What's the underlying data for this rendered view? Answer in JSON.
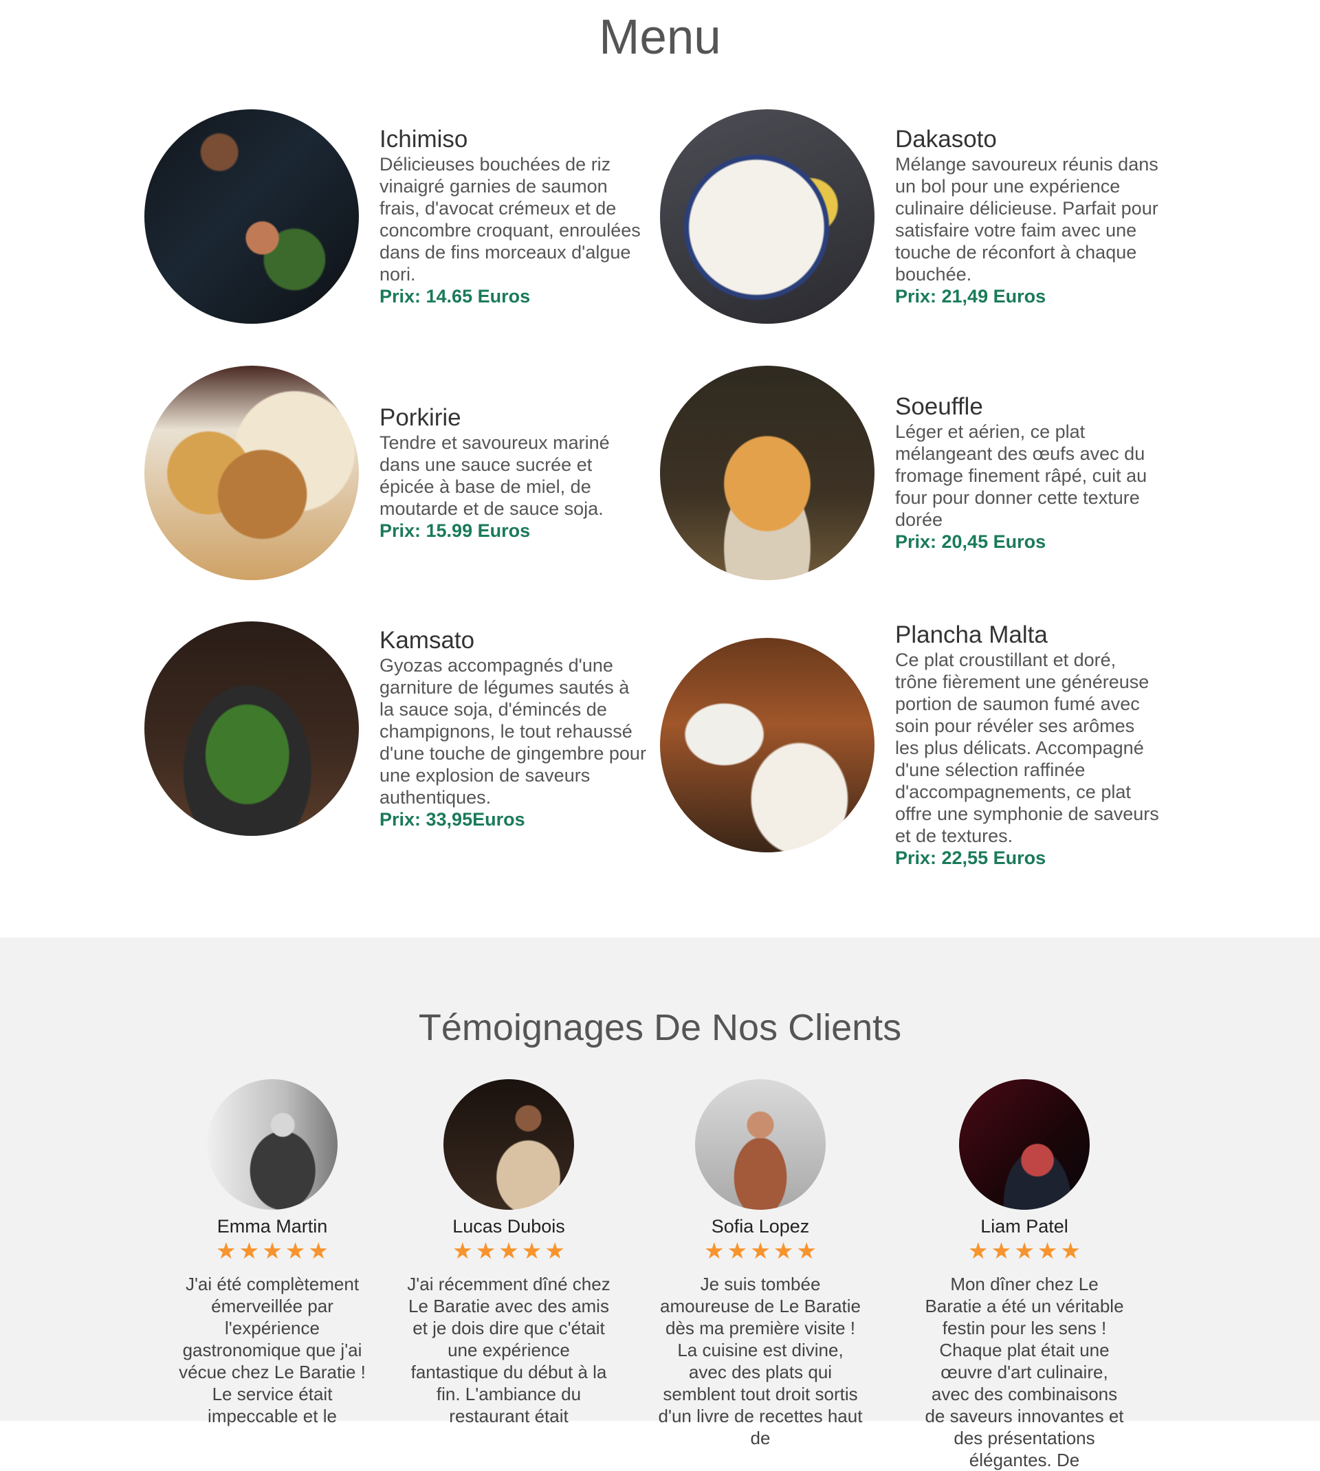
{
  "menu": {
    "title": "Menu",
    "dishes": [
      {
        "name": "Ichimiso",
        "description": "Délicieuses bouchées de riz vinaigré garnies de saumon frais, d'avocat crémeux et de concombre croquant, enroulées dans de fins morceaux d'algue nori.",
        "price": "Prix: 14.65 Euros"
      },
      {
        "name": "Dakasoto",
        "description": "Mélange savoureux réunis dans un bol pour une expérience culinaire délicieuse. Parfait pour satisfaire votre faim avec une touche de réconfort à chaque bouchée.",
        "price": "Prix: 21,49 Euros"
      },
      {
        "name": "Porkirie",
        "description": "Tendre et savoureux mariné dans une sauce sucrée et épicée à base de miel, de moutarde et de sauce soja.",
        "price": "Prix: 15.99 Euros"
      },
      {
        "name": "Soeuffle",
        "description": "Léger et aérien, ce plat mélangeant des œufs avec du fromage finement râpé, cuit au four pour donner cette texture dorée",
        "price": "Prix: 20,45 Euros"
      },
      {
        "name": "Kamsato",
        "description": "Gyozas accompagnés d'une garniture de légumes sautés à la sauce soja, d'émincés de champignons, le tout rehaussé d'une touche de gingembre pour une explosion de saveurs authentiques.",
        "price": "Prix: 33,95Euros"
      },
      {
        "name": "Plancha Malta",
        "description": "Ce plat croustillant et doré, trône fièrement une généreuse portion de saumon fumé avec soin pour révéler ses arômes les plus délicats. Accompagné d'une sélection raffinée d'accompagnements, ce plat offre une symphonie de saveurs et de textures.",
        "price": "Prix: 22,55 Euros"
      }
    ]
  },
  "testimonials": {
    "title": "Témoignages De Nos Clients",
    "rating_max": 5,
    "star_glyph": "★",
    "items": [
      {
        "name": "Emma Martin",
        "rating": 5,
        "quote": "J'ai été complètement émerveillée par l'expérience gastronomique que j'ai vécue chez Le Baratie ! Le service était impeccable et le"
      },
      {
        "name": "Lucas Dubois",
        "rating": 5,
        "quote": "J'ai récemment dîné chez Le Baratie avec des amis et je dois dire que c'était une expérience fantastique du début à la fin. L'ambiance du restaurant était"
      },
      {
        "name": "Sofia Lopez",
        "rating": 5,
        "quote": "Je suis tombée amoureuse de Le Baratie dès ma première visite ! La cuisine est divine, avec des plats qui semblent tout droit sortis d'un livre de recettes haut de"
      },
      {
        "name": "Liam Patel",
        "rating": 5,
        "quote": "Mon dîner chez Le Baratie a été un véritable festin pour les sens ! Chaque plat était une œuvre d'art culinaire, avec des combinaisons de saveurs innovantes et des présentations élégantes. De"
      }
    ]
  },
  "colors": {
    "price": "#1a7a5a",
    "star": "#f7942e",
    "testimonial_bg": "#f2f2f2"
  }
}
